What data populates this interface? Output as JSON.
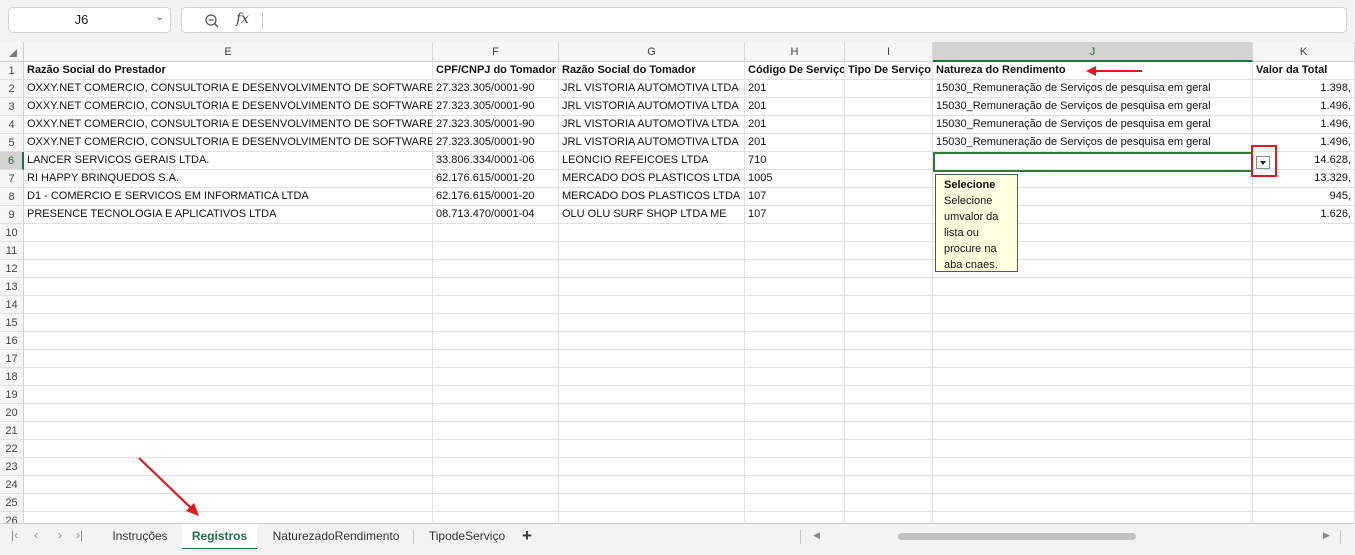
{
  "name_box": {
    "value": "J6"
  },
  "formula": {
    "fx_label": "fx",
    "value": ""
  },
  "columns": [
    "E",
    "F",
    "G",
    "H",
    "I",
    "J",
    "K"
  ],
  "row_numbers": [
    "1",
    "2",
    "3",
    "4",
    "5",
    "6",
    "7",
    "8",
    "9",
    "10",
    "11",
    "12",
    "13",
    "14",
    "15",
    "16",
    "17",
    "18",
    "19",
    "20",
    "21",
    "22",
    "23",
    "24",
    "25",
    "26"
  ],
  "header_row": [
    "Razão Social do Prestador",
    "CPF/CNPJ do Tomador",
    "Razão Social do Tomador",
    "Código De Serviço",
    "Tipo De Serviço",
    "Natureza do Rendimento",
    "Valor da Total"
  ],
  "data_rows": [
    [
      "OXXY.NET COMERCIO, CONSULTORIA E DESENVOLVIMENTO DE SOFTWARES",
      "27.323.305/0001-90",
      "JRL VISTORIA AUTOMOTIVA LTDA",
      "201",
      "",
      "15030_Remuneração de Serviços de pesquisa em geral",
      "1.398,"
    ],
    [
      "OXXY.NET COMERCIO, CONSULTORIA E DESENVOLVIMENTO DE SOFTWARES",
      "27.323.305/0001-90",
      "JRL VISTORIA AUTOMOTIVA LTDA",
      "201",
      "",
      "15030_Remuneração de Serviços de pesquisa em geral",
      "1.496,"
    ],
    [
      "OXXY.NET COMERCIO, CONSULTORIA E DESENVOLVIMENTO DE SOFTWARES",
      "27.323.305/0001-90",
      "JRL VISTORIA AUTOMOTIVA LTDA",
      "201",
      "",
      "15030_Remuneração de Serviços de pesquisa em geral",
      "1.496,"
    ],
    [
      "OXXY.NET COMERCIO, CONSULTORIA E DESENVOLVIMENTO DE SOFTWARES",
      "27.323.305/0001-90",
      "JRL VISTORIA AUTOMOTIVA LTDA",
      "201",
      "",
      "15030_Remuneração de Serviços de pesquisa em geral",
      "1.496,"
    ],
    [
      "LANCER SERVICOS GERAIS LTDA.",
      "33.806.334/0001-06",
      "LEONCIO REFEICOES LTDA",
      "710",
      "",
      "",
      "14.628,"
    ],
    [
      "RI HAPPY BRINQUEDOS S.A.",
      "62.176.615/0001-20",
      "MERCADO DOS PLASTICOS LTDA",
      "1005",
      "",
      "",
      "13.329,"
    ],
    [
      "D1 - COMERCIO E SERVICOS EM INFORMATICA LTDA",
      "62.176.615/0001-20",
      "MERCADO DOS PLASTICOS LTDA",
      "107",
      "",
      "",
      "945,"
    ],
    [
      "PRESENCE TECNOLOGIA E APLICATIVOS LTDA",
      "08.713.470/0001-04",
      "OLU OLU SURF SHOP LTDA ME",
      "107",
      "",
      "",
      "1.626,"
    ]
  ],
  "validation_tip": {
    "title": "Selecione",
    "body_lines": [
      "Selecione",
      "umvalor da",
      "lista ou",
      "procure na",
      "aba cnaes."
    ]
  },
  "sheet_tabs": [
    "Instruções",
    "Registros",
    "NaturezadoRendimento",
    "TipodeServiço"
  ],
  "active_tab": "Registros",
  "add_sheet_label": "+",
  "colors": {
    "accent_green": "#1e7145",
    "annotation_red": "#e01b1b",
    "tooltip_bg": "#ffffe1"
  }
}
